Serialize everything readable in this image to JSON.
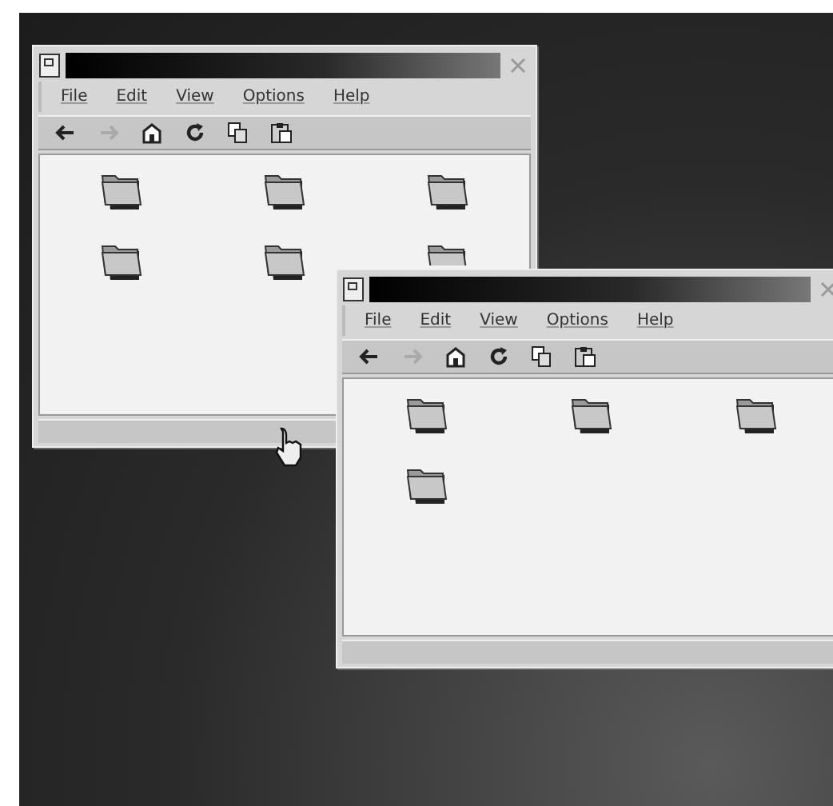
{
  "windows": [
    {
      "menu": [
        "File",
        "Edit",
        "View",
        "Options",
        "Help"
      ],
      "toolbar": [
        {
          "kind": "back",
          "disabled": false
        },
        {
          "kind": "forward",
          "disabled": true
        },
        {
          "kind": "home",
          "disabled": false
        },
        {
          "kind": "reload",
          "disabled": false
        },
        {
          "kind": "copy",
          "disabled": false
        },
        {
          "kind": "paste",
          "disabled": false
        }
      ],
      "items": [
        {
          "kind": "folder"
        },
        {
          "kind": "folder"
        },
        {
          "kind": "folder"
        },
        {
          "kind": "folder"
        },
        {
          "kind": "folder"
        },
        {
          "kind": "folder"
        }
      ]
    },
    {
      "menu": [
        "File",
        "Edit",
        "View",
        "Options",
        "Help"
      ],
      "toolbar": [
        {
          "kind": "back",
          "disabled": false
        },
        {
          "kind": "forward",
          "disabled": true
        },
        {
          "kind": "home",
          "disabled": false
        },
        {
          "kind": "reload",
          "disabled": false
        },
        {
          "kind": "copy",
          "disabled": false
        },
        {
          "kind": "paste",
          "disabled": false
        }
      ],
      "items": [
        {
          "kind": "folder"
        },
        {
          "kind": "folder"
        },
        {
          "kind": "folder"
        },
        {
          "kind": "folder"
        }
      ]
    }
  ]
}
